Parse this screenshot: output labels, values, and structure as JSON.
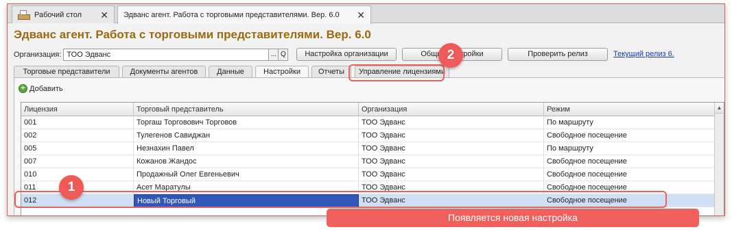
{
  "window_tabs": [
    {
      "label": "Рабочий стол",
      "close": "✕"
    },
    {
      "label": "Эдванс агент. Работа с торговыми представителями. Вер. 6.0",
      "close": "✕"
    }
  ],
  "title": "Эдванс агент. Работа с торговыми представителями. Вер. 6.0",
  "org": {
    "label": "Организация:",
    "value": "ТОО Эдванс",
    "dots": "...",
    "search_glyph": "Q"
  },
  "buttons": {
    "settings_org": "Настройка организации",
    "common": "Общие настройки",
    "check_release": "Проверить релиз",
    "current_release": "Текущий релиз 6."
  },
  "form_tabs": [
    "Торговые представители",
    "Документы агентов",
    "Данные",
    "Настройки",
    "Отчеты",
    "Управление лицензиями"
  ],
  "add_label": "Добавить",
  "table": {
    "columns": [
      "Лицензия",
      "Торговый представитель",
      "Организация",
      "Режим"
    ],
    "rows": [
      [
        "001",
        "Торгаш Торговович Торговов",
        "ТОО Эдванс",
        "По маршруту"
      ],
      [
        "002",
        "Тулегенов Савиджан",
        "ТОО Эдванс",
        "Свободное посещение"
      ],
      [
        "005",
        "Незнахин Павел",
        "ТОО Эдванс",
        "По маршруту"
      ],
      [
        "007",
        "Кожанов Жандос",
        "ТОО Эдванс",
        "Свободное посещение"
      ],
      [
        "010",
        "Продажный Олег Евгеньевич",
        "ТОО Эдванс",
        "Свободное посещение"
      ],
      [
        "011",
        "Асет Маратулы",
        "ТОО Эдванс",
        "Свободное посещение"
      ],
      [
        "012",
        "Новый Торговый",
        "ТОО Эдванс",
        "Свободное посещение"
      ]
    ]
  },
  "annotations": {
    "badge1": "1",
    "badge2": "2",
    "banner": "Появляется новая настройка",
    "color": "#ee5a57"
  }
}
